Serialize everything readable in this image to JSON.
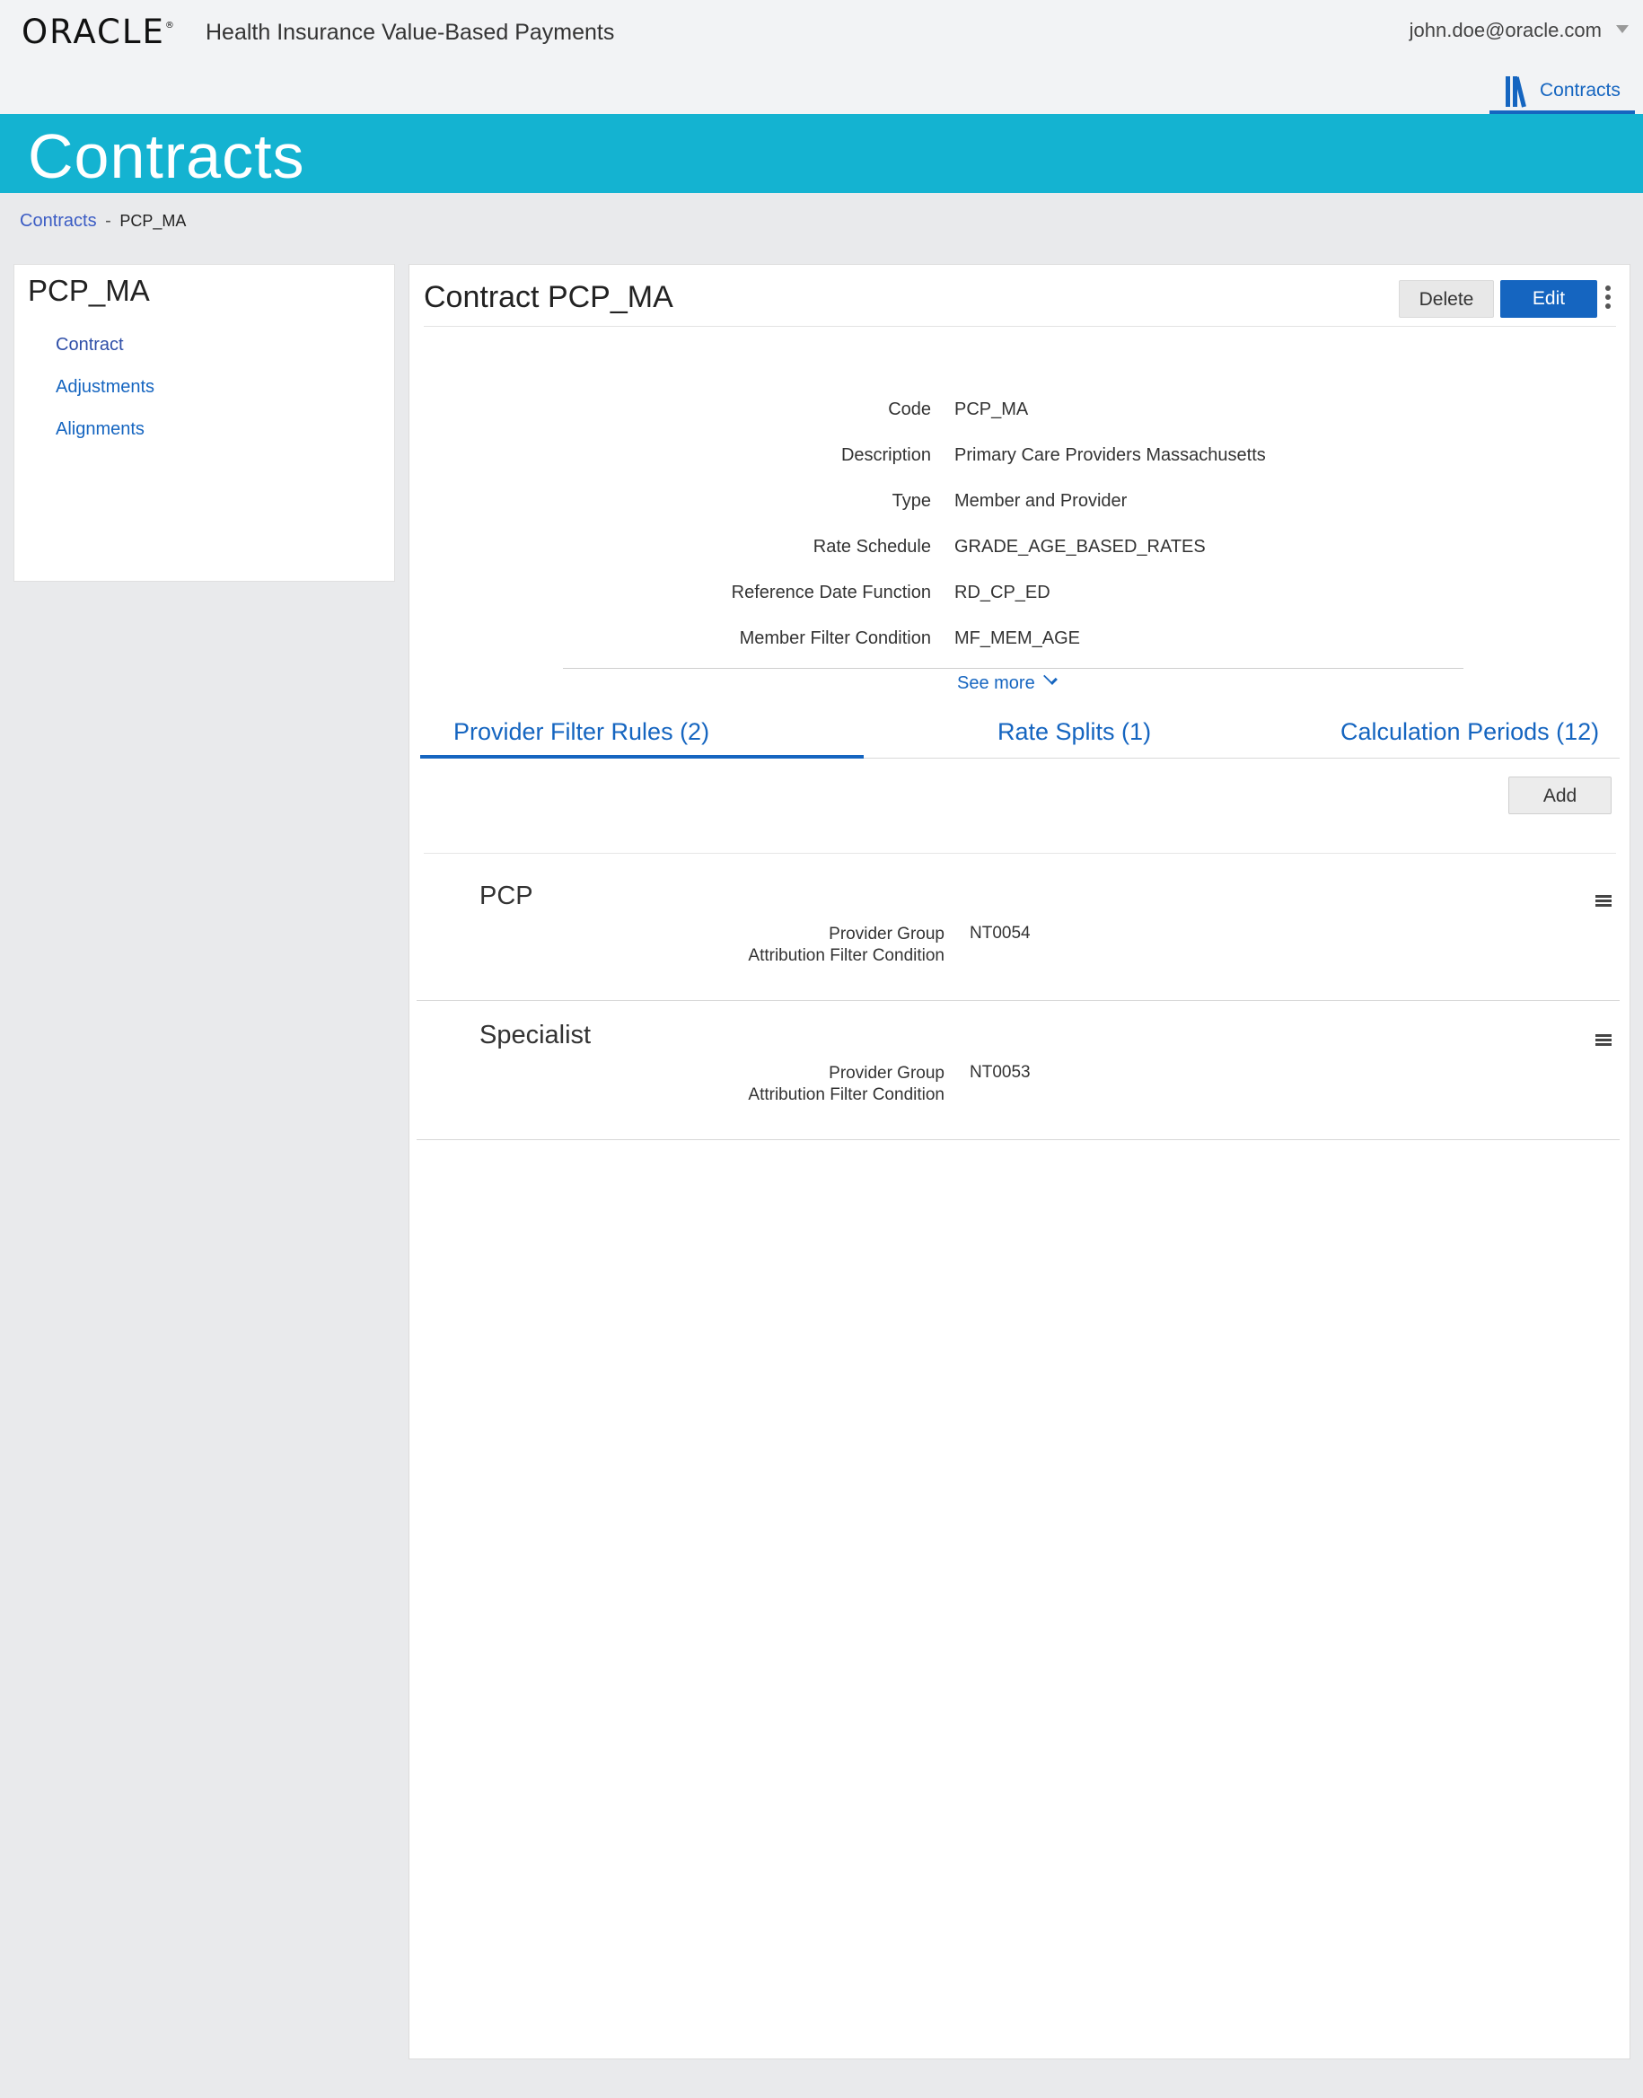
{
  "header": {
    "logo": "ORACLE",
    "app_name": "Health Insurance Value-Based Payments",
    "user": "john.doe@oracle.com",
    "nav_tab": "Contracts"
  },
  "banner": {
    "title": "Contracts"
  },
  "breadcrumb": {
    "parent": "Contracts",
    "separator": "-",
    "current": "PCP_MA"
  },
  "sidebar": {
    "title": "PCP_MA",
    "items": [
      {
        "label": "Contract"
      },
      {
        "label": "Adjustments"
      },
      {
        "label": "Alignments"
      }
    ]
  },
  "main": {
    "title": "Contract PCP_MA",
    "delete_label": "Delete",
    "edit_label": "Edit",
    "fields": [
      {
        "key": "Code",
        "value": "PCP_MA"
      },
      {
        "key": "Description",
        "value": "Primary Care Providers Massachusetts"
      },
      {
        "key": "Type",
        "value": "Member and Provider"
      },
      {
        "key": "Rate Schedule",
        "value": "GRADE_AGE_BASED_RATES"
      },
      {
        "key": "Reference Date Function",
        "value": "RD_CP_ED"
      },
      {
        "key": "Member Filter Condition",
        "value": "MF_MEM_AGE"
      }
    ],
    "see_more": "See more",
    "tabs": [
      {
        "label": "Provider Filter Rules (2)"
      },
      {
        "label": "Rate Splits (1)"
      },
      {
        "label": "Calculation Periods (12)"
      }
    ],
    "add_label": "Add",
    "rules": [
      {
        "name": "PCP",
        "k1": "Provider Group",
        "k2": "Attribution Filter Condition",
        "v1": "NT0054"
      },
      {
        "name": "Specialist",
        "k1": "Provider Group",
        "k2": "Attribution Filter Condition",
        "v1": "NT0053"
      }
    ]
  }
}
